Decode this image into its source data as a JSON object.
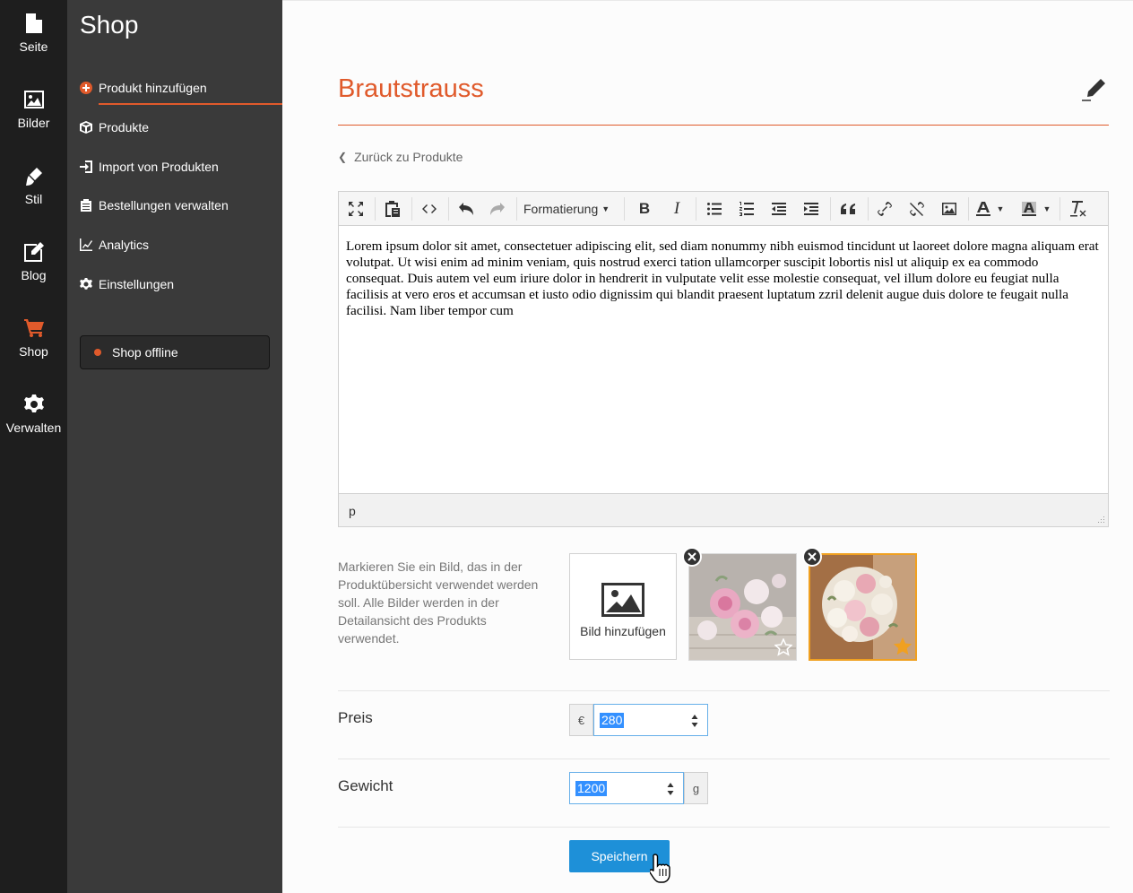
{
  "rail": {
    "items": [
      {
        "label": "Seite",
        "icon": "page-icon"
      },
      {
        "label": "Bilder",
        "icon": "image-icon"
      },
      {
        "label": "Stil",
        "icon": "brush-icon"
      },
      {
        "label": "Blog",
        "icon": "edit-square-icon"
      },
      {
        "label": "Shop",
        "icon": "cart-icon",
        "active": true
      },
      {
        "label": "Verwalten",
        "icon": "gear-icon"
      }
    ]
  },
  "subnav": {
    "title": "Shop",
    "items": [
      {
        "label": "Produkt hinzufügen",
        "icon": "plus-circle-icon",
        "active": true
      },
      {
        "label": "Produkte",
        "icon": "box-icon"
      },
      {
        "label": "Import von Produkten",
        "icon": "import-icon"
      },
      {
        "label": "Bestellungen verwalten",
        "icon": "clipboard-icon"
      },
      {
        "label": "Analytics",
        "icon": "chart-line-icon"
      },
      {
        "label": "Einstellungen",
        "icon": "gear-icon"
      }
    ],
    "shop_status": "Shop offline"
  },
  "main": {
    "title": "Brautstrauss",
    "back_link": "Zurück zu Produkte",
    "editor": {
      "format_label": "Formatierung",
      "content": "Lorem ipsum dolor sit amet, consectetuer adipiscing elit, sed diam nonummy nibh euismod tincidunt ut laoreet dolore magna aliquam erat volutpat. Ut wisi enim ad minim veniam, quis nostrud exerci tation ullamcorper suscipit lobortis nisl ut aliquip ex ea commodo consequat. Duis autem vel eum iriure dolor in hendrerit in vulputate velit esse molestie consequat, vel illum dolore eu feugiat nulla facilisis at vero eros et accumsan et iusto odio dignissim qui blandit praesent luptatum zzril delenit augue duis dolore te feugait nulla facilisi. Nam liber tempor cum",
      "status_path": "p"
    },
    "images": {
      "help_text": "Markieren Sie ein Bild, das in der Produktübersicht verwendet werden soll. Alle Bilder werden in der Detailansicht des Produkts verwendet.",
      "add_label": "Bild hinzufügen"
    },
    "price": {
      "label": "Preis",
      "currency": "€",
      "value": "280"
    },
    "weight": {
      "label": "Gewicht",
      "value": "1200",
      "unit": "g"
    },
    "save_label": "Speichern"
  },
  "colors": {
    "accent": "#e05a2b",
    "primary_button": "#1e90d8",
    "featured_border": "#f0a020"
  }
}
